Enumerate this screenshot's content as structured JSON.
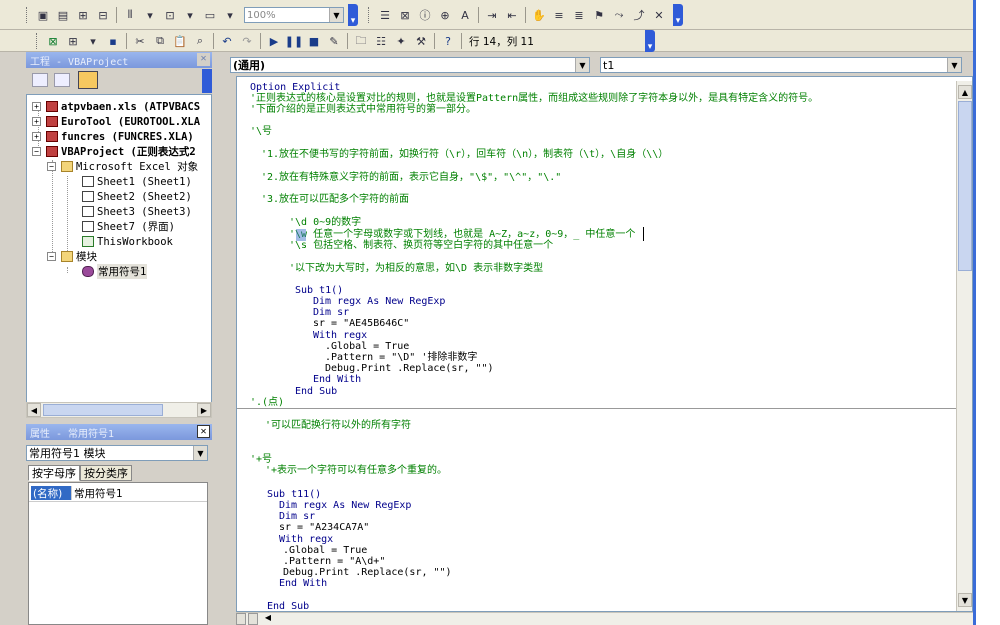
{
  "toolbar": {
    "zoom_value": "100%",
    "cursor_position": "行 14，列 11"
  },
  "project_panel": {
    "title": "工程 - VBAProject",
    "tree": [
      {
        "label": "atpvbaen.xls (ATPVBACS",
        "bold": true
      },
      {
        "label": "EuroTool (EUROTOOL.XLA",
        "bold": true
      },
      {
        "label": "funcres (FUNCRES.XLA)",
        "bold": true
      },
      {
        "label": "VBAProject (正则表达式2",
        "bold": true
      },
      {
        "label": "Microsoft Excel 对象",
        "bold": false
      },
      {
        "label": "Sheet1 (Sheet1)",
        "bold": false
      },
      {
        "label": "Sheet2 (Sheet2)",
        "bold": false
      },
      {
        "label": "Sheet3 (Sheet3)",
        "bold": false
      },
      {
        "label": "Sheet7 (界面)",
        "bold": false
      },
      {
        "label": "ThisWorkbook",
        "bold": false
      },
      {
        "label": "模块",
        "bold": false
      },
      {
        "label": "常用符号1",
        "bold": false
      }
    ]
  },
  "properties_panel": {
    "title": "属性 - 常用符号1",
    "object_combo": "常用符号1 模块",
    "tab_alpha": "按字母序",
    "tab_category": "按分类序",
    "prop_name": "(名称)",
    "prop_value": "常用符号1"
  },
  "code_window": {
    "object_combo": "(通用)",
    "proc_combo": "t1",
    "lines": [
      {
        "t": "Option Explicit",
        "c": "kw"
      },
      {
        "t": "'正则表达式的核心是设置对比的规则，也就是设置Pattern属性，而组成这些规则除了字符本身以外，是具有特定含义的符号。",
        "c": "cm"
      },
      {
        "t": "'下面介绍的是正则表达式中常用符号的第一部分。",
        "c": "cm"
      },
      {
        "t": "'\\号",
        "c": "cm"
      },
      {
        "t": "'1.放在不便书写的字符前面，如换行符（\\r），回车符（\\n），制表符（\\t），\\自身（\\\\）",
        "c": "cm"
      },
      {
        "t": "'2.放在有特殊意义字符的前面，表示它自身，\"\\$\"，\"\\^\"，\"\\.\"",
        "c": "cm"
      },
      {
        "t": "'3.放在可以匹配多个字符的前面",
        "c": "cm"
      },
      {
        "t": "'\\d 0~9的数字",
        "c": "cm"
      },
      {
        "t": "'\\w 任意一个字母或数字或下划线，也就是 A~Z，a~z，0~9，_ 中任意一个",
        "c": "cm"
      },
      {
        "t": "'\\s 包括空格、制表符、换页符等空白字符的其中任意一个",
        "c": "cm"
      },
      {
        "t": "'以下改为大写时，为相反的意思，如\\D 表示非数字类型",
        "c": "cm"
      },
      {
        "t": "Sub t1()",
        "c": "kw"
      },
      {
        "t": "Dim regx As New RegExp",
        "c": "kw"
      },
      {
        "t": "Dim sr",
        "c": "kw"
      },
      {
        "t": "sr = \"AE45B646C\"",
        "c": "pl"
      },
      {
        "t": "With regx",
        "c": "kw"
      },
      {
        "t": ".Global = True",
        "c": "pl"
      },
      {
        "t": ".Pattern = \"\\D\" '排除非数字",
        "c": "pl"
      },
      {
        "t": "Debug.Print .Replace(sr, \"\")",
        "c": "pl"
      },
      {
        "t": "End With",
        "c": "kw"
      },
      {
        "t": "End Sub",
        "c": "kw"
      },
      {
        "t": "'.(点)",
        "c": "cm"
      },
      {
        "t": "'可以匹配换行符以外的所有字符",
        "c": "cm"
      },
      {
        "t": "'+号",
        "c": "cm"
      },
      {
        "t": "'+表示一个字符可以有任意多个重复的。",
        "c": "cm"
      },
      {
        "t": "Sub t11()",
        "c": "kw"
      },
      {
        "t": "Dim regx As New RegExp",
        "c": "kw"
      },
      {
        "t": "Dim sr",
        "c": "kw"
      },
      {
        "t": "sr = \"A234CA7A\"",
        "c": "pl"
      },
      {
        "t": "With regx",
        "c": "kw"
      },
      {
        "t": ".Global = True",
        "c": "pl"
      },
      {
        "t": ".Pattern = \"A\\d+\"",
        "c": "pl"
      },
      {
        "t": "Debug.Print .Replace(sr, \"\")",
        "c": "pl"
      },
      {
        "t": "End With",
        "c": "kw"
      },
      {
        "t": "End Sub",
        "c": "kw"
      }
    ]
  }
}
